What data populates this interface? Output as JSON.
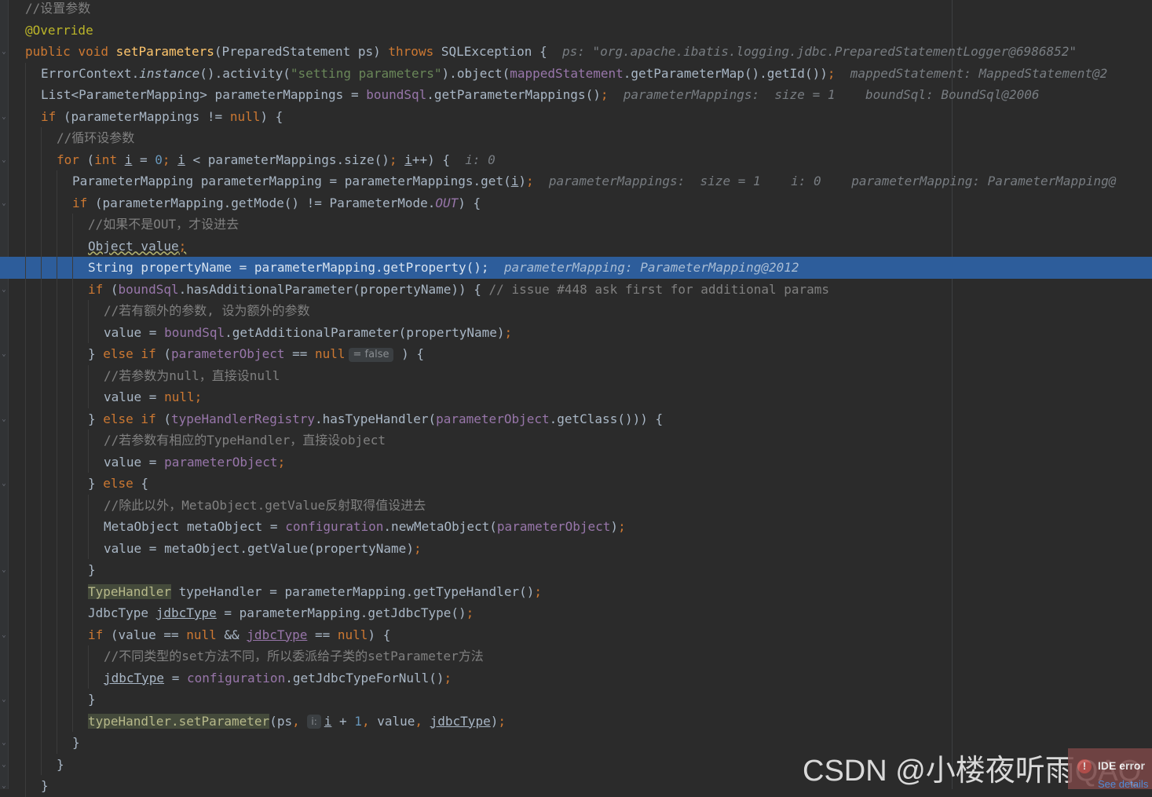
{
  "editor": {
    "lines": [
      [
        {
          "t": "//设置参数",
          "c": "cm"
        }
      ],
      [
        {
          "t": "@Override",
          "c": "ann"
        }
      ],
      [
        {
          "t": "public",
          "c": "kw"
        },
        {
          "t": " "
        },
        {
          "t": "void",
          "c": "kw"
        },
        {
          "t": " "
        },
        {
          "t": "setParameters",
          "c": "fn"
        },
        {
          "t": "(PreparedStatement ps) "
        },
        {
          "t": "throws",
          "c": "kw"
        },
        {
          "t": " SQLException {  "
        },
        {
          "t": "ps: \"org.apache.ibatis.logging.jdbc.PreparedStatementLogger@6986852\"",
          "c": "inlay"
        }
      ],
      [
        {
          "t": "ErrorContext."
        },
        {
          "t": "instance",
          "c": "italic"
        },
        {
          "t": "().activity("
        },
        {
          "t": "\"setting parameters\"",
          "c": "str"
        },
        {
          "t": ").object("
        },
        {
          "t": "mappedStatement",
          "c": "field"
        },
        {
          "t": ".getParameterMap().getId())"
        },
        {
          "t": ";",
          "c": "kw"
        },
        {
          "t": "  "
        },
        {
          "t": "mappedStatement: MappedStatement@2",
          "c": "inlay"
        }
      ],
      [
        {
          "t": "List<ParameterMapping> parameterMappings = "
        },
        {
          "t": "boundSql",
          "c": "field"
        },
        {
          "t": ".getParameterMappings()"
        },
        {
          "t": ";",
          "c": "kw"
        },
        {
          "t": "  "
        },
        {
          "t": "parameterMappings:  size = 1    boundSql: BoundSql@2006",
          "c": "inlay"
        }
      ],
      [
        {
          "t": "if",
          "c": "kw"
        },
        {
          "t": " (parameterMappings != "
        },
        {
          "t": "null",
          "c": "kw"
        },
        {
          "t": ") {"
        }
      ],
      [
        {
          "t": "//循环设参数",
          "c": "cm"
        }
      ],
      [
        {
          "t": "for",
          "c": "kw"
        },
        {
          "t": " ("
        },
        {
          "t": "int",
          "c": "kw"
        },
        {
          "t": " "
        },
        {
          "t": "i",
          "c": "ul"
        },
        {
          "t": " = "
        },
        {
          "t": "0",
          "c": "num"
        },
        {
          "t": "; ",
          "c": "kw"
        },
        {
          "t": "i",
          "c": "ul"
        },
        {
          "t": " < parameterMappings.size()"
        },
        {
          "t": "; ",
          "c": "kw"
        },
        {
          "t": "i",
          "c": "ul"
        },
        {
          "t": "++) {  "
        },
        {
          "t": "i: 0",
          "c": "inlay"
        }
      ],
      [
        {
          "t": "ParameterMapping parameterMapping = parameterMappings.get("
        },
        {
          "t": "i",
          "c": "ul"
        },
        {
          "t": ")"
        },
        {
          "t": ";",
          "c": "kw"
        },
        {
          "t": "  "
        },
        {
          "t": "parameterMappings:  size = 1    i: 0    parameterMapping: ParameterMapping@",
          "c": "inlay"
        }
      ],
      [
        {
          "t": "if",
          "c": "kw"
        },
        {
          "t": " (parameterMapping.getMode() != ParameterMode."
        },
        {
          "t": "OUT",
          "c": "static"
        },
        {
          "t": ") {"
        }
      ],
      [
        {
          "t": "//如果不是OUT，才设进去",
          "c": "cm"
        }
      ],
      [
        {
          "t": "Object value",
          "c": "warn-ul"
        },
        {
          "t": ";",
          "c": "kw warn-ul"
        }
      ],
      [
        {
          "t": "String propertyName = parameterMapping.getProperty();  "
        },
        {
          "t": "parameterMapping: ParameterMapping@2012",
          "c": "inlay"
        }
      ],
      [
        {
          "t": "if",
          "c": "kw"
        },
        {
          "t": " ("
        },
        {
          "t": "boundSql",
          "c": "field"
        },
        {
          "t": ".hasAdditionalParameter(propertyName)) { "
        },
        {
          "t": "// issue #448 ask first for additional params",
          "c": "cm"
        }
      ],
      [
        {
          "t": "//若有额外的参数, 设为额外的参数",
          "c": "cm"
        }
      ],
      [
        {
          "t": "value = "
        },
        {
          "t": "boundSql",
          "c": "field"
        },
        {
          "t": ".getAdditionalParameter(propertyName)"
        },
        {
          "t": ";",
          "c": "kw"
        }
      ],
      [
        {
          "t": "} "
        },
        {
          "t": "else if",
          "c": "kw"
        },
        {
          "t": " ("
        },
        {
          "t": "parameterObject",
          "c": "field"
        },
        {
          "t": " == "
        },
        {
          "t": "null",
          "c": "kw"
        },
        {
          "t": "= false",
          "c": "bool-hint"
        },
        {
          "t": " ) {"
        }
      ],
      [
        {
          "t": "//若参数为null，直接设null",
          "c": "cm"
        }
      ],
      [
        {
          "t": "value = "
        },
        {
          "t": "null",
          "c": "kw"
        },
        {
          "t": ";",
          "c": "kw"
        }
      ],
      [
        {
          "t": "} "
        },
        {
          "t": "else if",
          "c": "kw"
        },
        {
          "t": " ("
        },
        {
          "t": "typeHandlerRegistry",
          "c": "field"
        },
        {
          "t": ".hasTypeHandler("
        },
        {
          "t": "parameterObject",
          "c": "field"
        },
        {
          "t": ".getClass())) {"
        }
      ],
      [
        {
          "t": "//若参数有相应的TypeHandler，直接设object",
          "c": "cm"
        }
      ],
      [
        {
          "t": "value = "
        },
        {
          "t": "parameterObject",
          "c": "field"
        },
        {
          "t": ";",
          "c": "kw"
        }
      ],
      [
        {
          "t": "} "
        },
        {
          "t": "else",
          "c": "kw"
        },
        {
          "t": " {"
        }
      ],
      [
        {
          "t": "//除此以外，MetaObject.getValue反射取得值设进去",
          "c": "cm"
        }
      ],
      [
        {
          "t": "MetaObject metaObject = "
        },
        {
          "t": "configuration",
          "c": "field"
        },
        {
          "t": ".newMetaObject("
        },
        {
          "t": "parameterObject",
          "c": "field"
        },
        {
          "t": ")"
        },
        {
          "t": ";",
          "c": "kw"
        }
      ],
      [
        {
          "t": "value = metaObject.getValue(propertyName)"
        },
        {
          "t": ";",
          "c": "kw"
        }
      ],
      [
        {
          "t": "}"
        }
      ],
      [
        {
          "t": "TypeHandler",
          "c": "hl"
        },
        {
          "t": " typeHandler = parameterMapping.getTypeHandler()"
        },
        {
          "t": ";",
          "c": "kw"
        }
      ],
      [
        {
          "t": "JdbcType "
        },
        {
          "t": "jdbcType",
          "c": "ul"
        },
        {
          "t": " = parameterMapping.getJdbcType()"
        },
        {
          "t": ";",
          "c": "kw"
        }
      ],
      [
        {
          "t": "if",
          "c": "kw"
        },
        {
          "t": " (value == "
        },
        {
          "t": "null",
          "c": "kw"
        },
        {
          "t": " && "
        },
        {
          "t": "jdbcType",
          "c": "ul field"
        },
        {
          "t": " == "
        },
        {
          "t": "null",
          "c": "kw"
        },
        {
          "t": ") {"
        }
      ],
      [
        {
          "t": "//不同类型的set方法不同，所以委派给子类的setParameter方法",
          "c": "cm"
        }
      ],
      [
        {
          "t": "jdbcType",
          "c": "ul"
        },
        {
          "t": " = "
        },
        {
          "t": "configuration",
          "c": "field"
        },
        {
          "t": ".getJdbcTypeForNull()"
        },
        {
          "t": ";",
          "c": "kw"
        }
      ],
      [
        {
          "t": "}"
        }
      ],
      [
        {
          "t": "typeHandler.setParameter",
          "c": "hl"
        },
        {
          "t": "(ps"
        },
        {
          "t": ", ",
          "c": "kw"
        },
        {
          "t": "i:",
          "c": "param-hint"
        },
        {
          "t": "i",
          "c": "ul"
        },
        {
          "t": " + "
        },
        {
          "t": "1",
          "c": "num"
        },
        {
          "t": ", ",
          "c": "kw"
        },
        {
          "t": "value"
        },
        {
          "t": ", ",
          "c": "kw"
        },
        {
          "t": "jdbcType",
          "c": "ul"
        },
        {
          "t": ")"
        },
        {
          "t": ";",
          "c": "kw"
        }
      ],
      [
        {
          "t": "}"
        }
      ],
      [
        {
          "t": "}"
        }
      ],
      [
        {
          "t": "}"
        }
      ]
    ]
  },
  "watermark": "CSDN @小楼夜听雨QAQ",
  "notification": {
    "title": "IDE error",
    "link": "See details"
  }
}
